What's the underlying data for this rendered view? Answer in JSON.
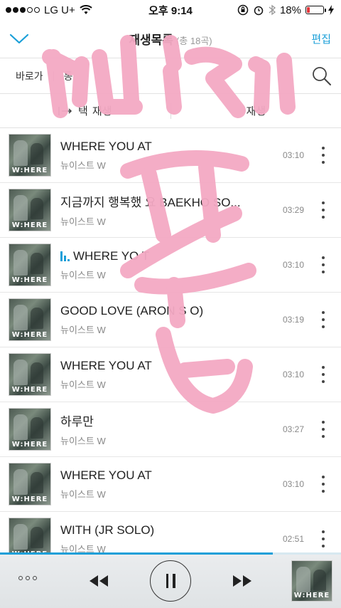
{
  "status_bar": {
    "carrier": "LG U+",
    "time": "오후 9:14",
    "battery": "18%"
  },
  "header": {
    "title": "재생목록",
    "count": "(총 18곡)",
    "edit_label": "편집"
  },
  "shortcut": {
    "item1": "바로가",
    "item2": "동"
  },
  "actions": {
    "left_label": "택",
    "left_label_suffix": "재생",
    "right_label": "재생"
  },
  "tracks": [
    {
      "title": "WHERE YOU AT",
      "artist": "뉴이스트 W",
      "duration": "03:10",
      "playing": false
    },
    {
      "title": "지금까지 행복했    요 BAEKHO SO...",
      "artist": "뉴이스트 W",
      "duration": "03:29",
      "playing": false
    },
    {
      "title": "WHERE YO   T",
      "artist": "뉴이스트 W",
      "duration": "03:10",
      "playing": true
    },
    {
      "title": "GOOD LOVE (ARON S   O)",
      "artist": "뉴이스트 W",
      "duration": "03:19",
      "playing": false
    },
    {
      "title": "WHERE YOU AT",
      "artist": "뉴이스트 W",
      "duration": "03:10",
      "playing": false
    },
    {
      "title": "하루만",
      "artist": "뉴이스트 W",
      "duration": "03:27",
      "playing": false
    },
    {
      "title": "WHERE YOU AT",
      "artist": "뉴이스트 W",
      "duration": "03:10",
      "playing": false
    },
    {
      "title": "WITH (JR SOLO)",
      "artist": "뉴이스트 W",
      "duration": "02:51",
      "playing": false
    }
  ],
  "album_label": "W:HERE",
  "player": {
    "progress": 0.8
  },
  "colors": {
    "accent": "#1a9fd8",
    "scribble": "#f4a9c4",
    "battery_low": "#e5363a"
  },
  "icons": {
    "back": "chevron-down-icon",
    "search": "search-icon",
    "more": "vertical-ellipsis-icon",
    "prev": "rewind-icon",
    "pause": "pause-icon",
    "next": "fast-forward-icon"
  }
}
